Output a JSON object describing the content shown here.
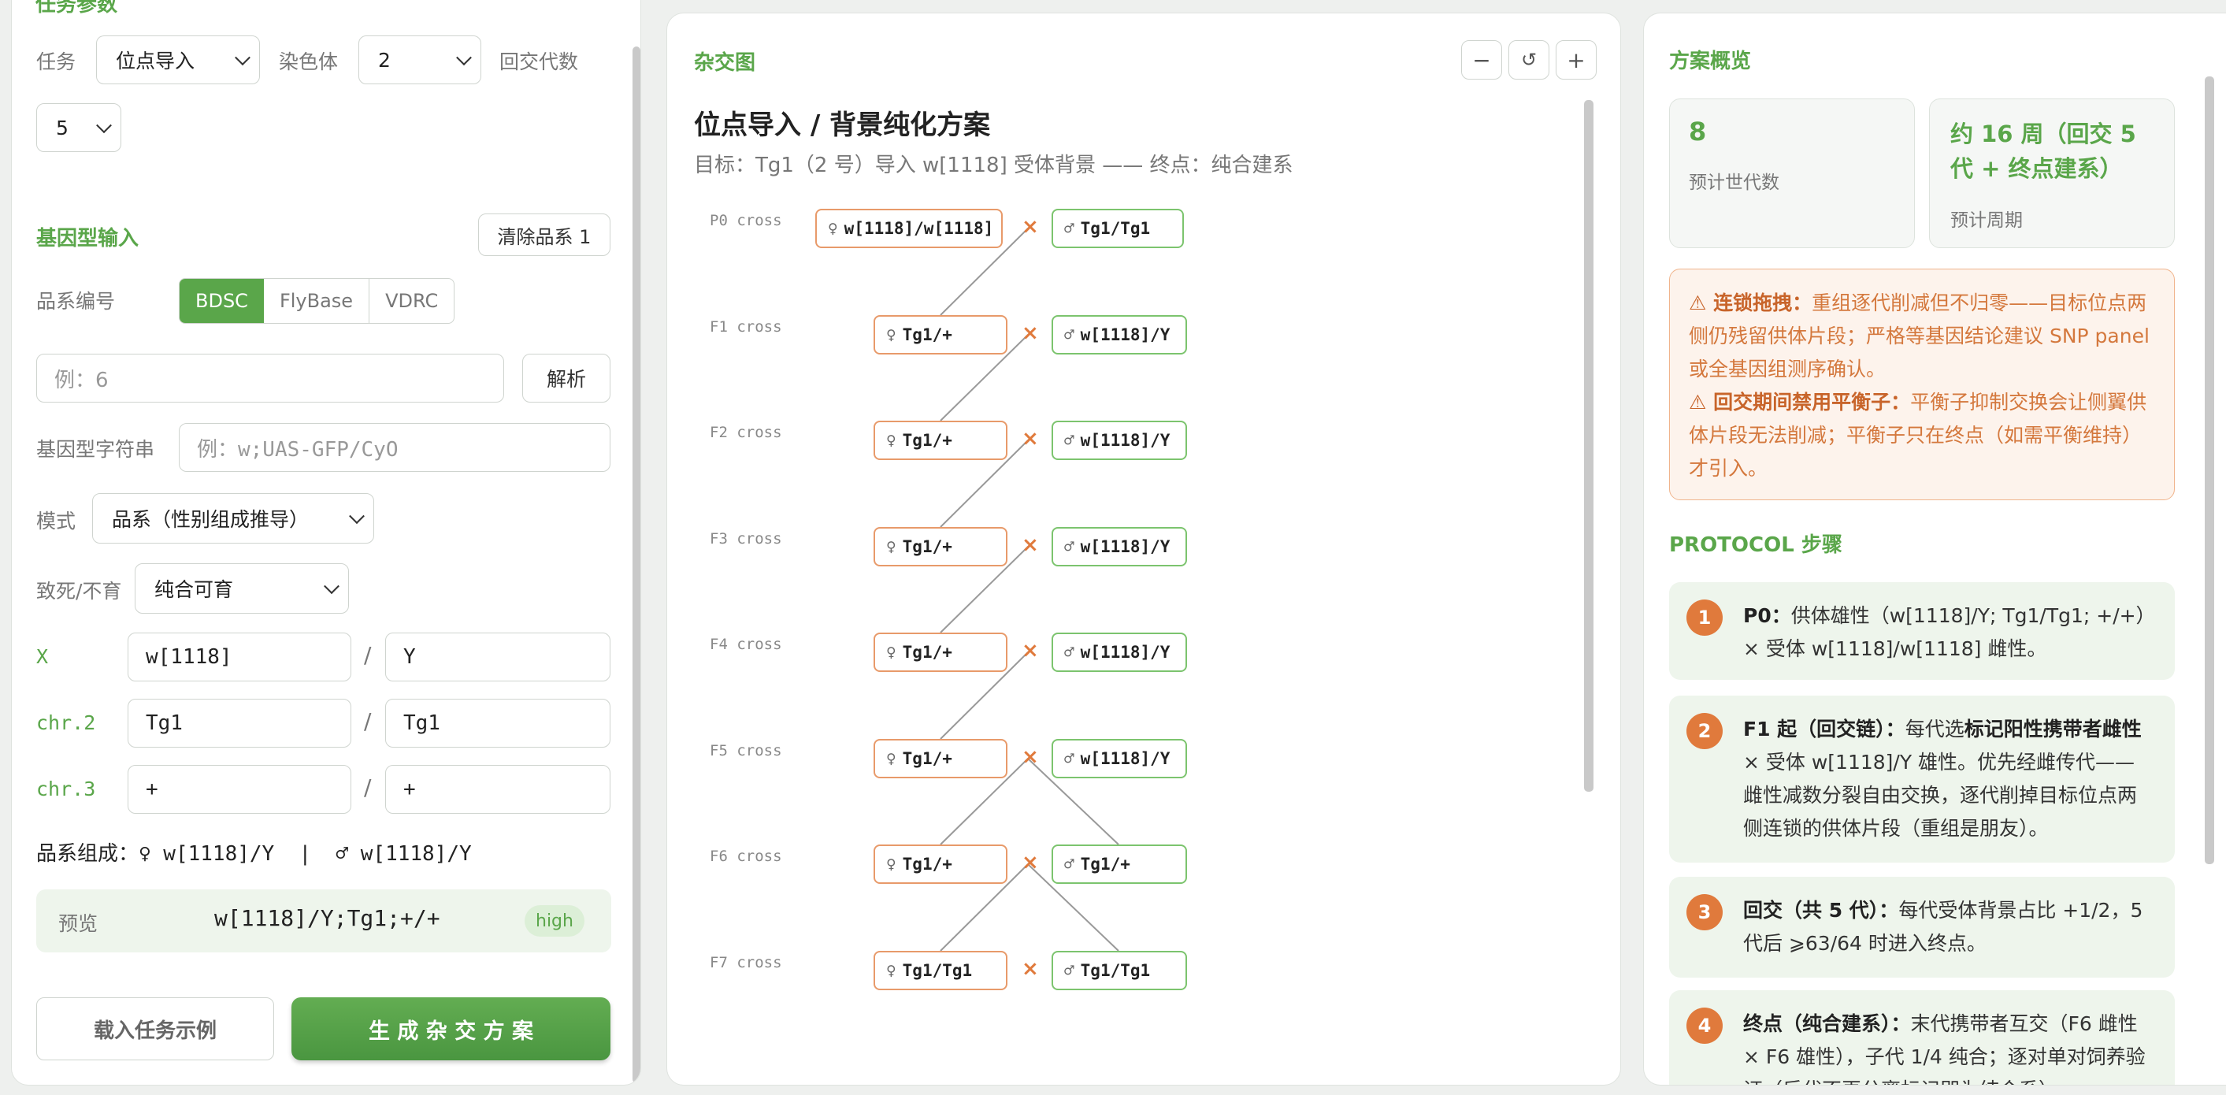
{
  "left": {
    "task_section_title": "任务参数",
    "task_label": "任务",
    "task_value": "位点导入",
    "chromosome_label": "染色体",
    "chromosome_value": "2",
    "backcross_label": "回交代数",
    "backcross_value": "5",
    "genotype_title": "基因型输入",
    "clear_button": "清除品系 1",
    "stock_id_label": "品系编号",
    "sources": [
      "BDSC",
      "FlyBase",
      "VDRC"
    ],
    "stock_placeholder": "例：6",
    "parse_button": "解析",
    "genotype_string_label": "基因型字符串",
    "genotype_placeholder": "例：w;UAS-GFP/CyO",
    "mode_label": "模式",
    "mode_value": "品系（性别组成推导）",
    "lethal_label": "致死/不育",
    "lethal_value": "纯合可育",
    "chromosomes": [
      {
        "label": "X",
        "a": "w[1118]",
        "b": "Y"
      },
      {
        "label": "chr.2",
        "a": "Tg1",
        "b": "Tg1"
      },
      {
        "label": "chr.3",
        "a": "+",
        "b": "+"
      }
    ],
    "composition": "品系组成：♀ w[1118]/Y  |  ♂ w[1118]/Y",
    "preview_label": "预览",
    "preview_value": "w[1118]/Y;Tg1;+/+",
    "preview_badge": "high",
    "load_example_button": "载入任务示例",
    "generate_button": "生 成 杂 交 方 案"
  },
  "mid": {
    "title": "杂交图",
    "zoom_out": "−",
    "reset": "↺",
    "zoom_in": "+",
    "plan_title": "位点导入 / 背景纯化方案",
    "plan_subtitle": "目标：Tg1（2 号）导入 w[1118] 受体背景 —— 终点：纯合建系",
    "cross_symbol": "×",
    "crosses": [
      {
        "gen": "P0 cross",
        "female": "w[1118]/w[1118]",
        "male": "Tg1/Tg1"
      },
      {
        "gen": "F1 cross",
        "female": "Tg1/+",
        "male": "w[1118]/Y"
      },
      {
        "gen": "F2 cross",
        "female": "Tg1/+",
        "male": "w[1118]/Y"
      },
      {
        "gen": "F3 cross",
        "female": "Tg1/+",
        "male": "w[1118]/Y"
      },
      {
        "gen": "F4 cross",
        "female": "Tg1/+",
        "male": "w[1118]/Y"
      },
      {
        "gen": "F5 cross",
        "female": "Tg1/+",
        "male": "w[1118]/Y"
      },
      {
        "gen": "F6 cross",
        "female": "Tg1/+",
        "male": "Tg1/+"
      },
      {
        "gen": "F7 cross",
        "female": "Tg1/Tg1",
        "male": "Tg1/Tg1"
      }
    ]
  },
  "right": {
    "title": "方案概览",
    "generations_value": "8",
    "generations_label": "预计世代数",
    "period_value": "约 16 周（回交 5 代 + 终点建系）",
    "period_label": "预计周期",
    "warning1_title": "⚠ 连锁拖拽：",
    "warning1_text": "重组逐代削减但不归零——目标位点两侧仍残留供体片段；严格等基因结论建议 SNP panel 或全基因组测序确认。",
    "warning2_title": "⚠ 回交期间禁用平衡子：",
    "warning2_text": "平衡子抑制交换会让侧翼供体片段无法削减；平衡子只在终点（如需平衡维持）才引入。",
    "protocol_title": "PROTOCOL 步骤",
    "steps": [
      {
        "num": "1",
        "head": "P0：",
        "text": "供体雄性（w[1118]/Y; Tg1/Tg1; +/+）× 受体 w[1118]/w[1118] 雌性。"
      },
      {
        "num": "2",
        "head": "F1 起（回交链）：",
        "text_pre": "每代选",
        "bold_mid": "标记阳性携带者雌性",
        "text_post": " × 受体 w[1118]/Y 雄性。优先经雌传代——雌性减数分裂自由交换，逐代削掉目标位点两侧连锁的供体片段（重组是朋友）。"
      },
      {
        "num": "3",
        "head": "回交（共 5 代）：",
        "text": "每代受体背景占比 +1/2，5 代后 ⩾63/64 时进入终点。"
      },
      {
        "num": "4",
        "head": "终点（纯合建系）：",
        "text": "末代携带者互交（F6 雌性 × F6 雄性），子代 1/4 纯合；逐对单对饲养验证（后代不再分离标记即为纯合系）。"
      }
    ]
  },
  "colors": {
    "accent": "#5aa64a",
    "female": "#e89a6a",
    "male": "#7cc46e",
    "warning": "#e07a3c"
  }
}
